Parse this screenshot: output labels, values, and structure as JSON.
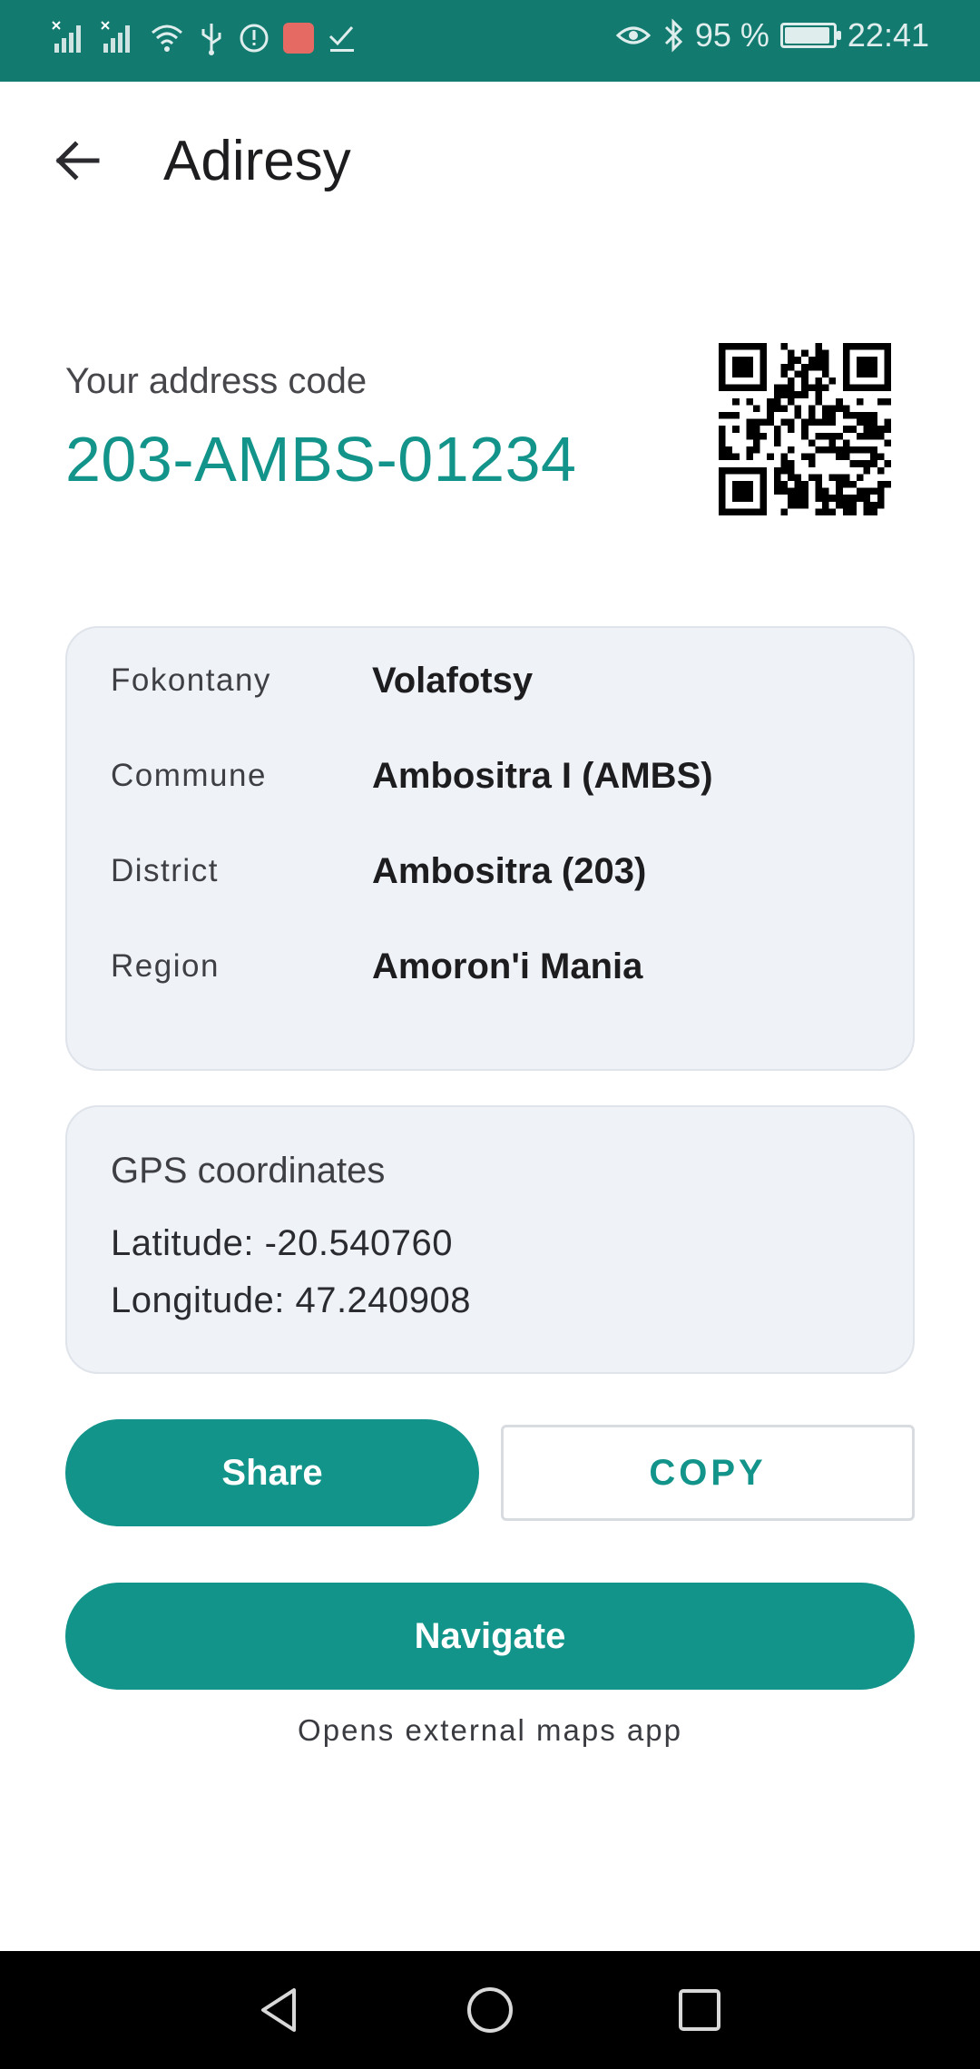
{
  "status_bar": {
    "battery_percent": "95 %",
    "battery_level": 0.95,
    "time": "22:41",
    "icons_left": [
      "signal-icon",
      "signal-icon",
      "wifi-icon",
      "usb-icon",
      "alert-icon",
      "huawei-icon",
      "check-icon"
    ],
    "icons_right": [
      "eye-icon",
      "bluetooth-icon",
      "battery-icon"
    ]
  },
  "app_bar": {
    "title": "Adiresy",
    "back_icon": "arrow-back-icon"
  },
  "address": {
    "label": "Your address code",
    "code": "203-AMBS-01234",
    "qr_icon": "qr-code-icon"
  },
  "details": [
    {
      "label": "Fokontany",
      "value": "Volafotsy"
    },
    {
      "label": "Commune",
      "value": "Ambositra I (AMBS)"
    },
    {
      "label": "District",
      "value": "Ambositra (203)"
    },
    {
      "label": "Region",
      "value": "Amoron'i Mania"
    }
  ],
  "gps": {
    "title": "GPS coordinates",
    "latitude": "Latitude: -20.540760",
    "longitude": "Longitude: 47.240908"
  },
  "actions": {
    "share_label": "Share",
    "copy_label": "COPY",
    "navigate_label": "Navigate",
    "navigate_hint": "Opens external maps app"
  },
  "colors": {
    "status_bar": "#137a70",
    "accent": "#12948a",
    "card_bg": "#eff2f7"
  }
}
